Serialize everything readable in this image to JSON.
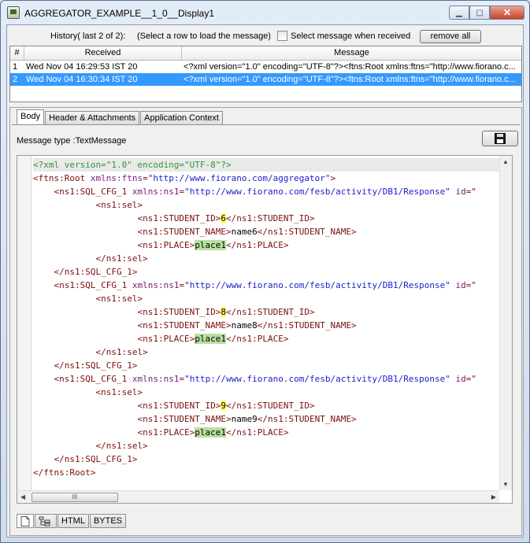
{
  "window": {
    "title": "AGGREGATOR_EXAMPLE__1_0__Display1",
    "minimize_icon": "minimize-icon",
    "maximize_icon": "maximize-icon",
    "close_icon": "close-icon"
  },
  "history": {
    "label": "History( last 2 of 2):",
    "instruction": "(Select a row to load the message)",
    "checkbox_label": "Select message when received",
    "checkbox_checked": false,
    "remove_all_label": "remove all"
  },
  "table": {
    "columns": [
      "#",
      "Received",
      "Message"
    ],
    "rows": [
      {
        "num": "1",
        "received": "Wed Nov 04 16:29:53 IST 20",
        "message": "<?xml version=\"1.0\" encoding=\"UTF-8\"?><ftns:Root xmlns:ftns=\"http://www.fiorano.c...",
        "selected": false
      },
      {
        "num": "2",
        "received": "Wed Nov 04 16:30:34 IST 20",
        "message": "<?xml version=\"1.0\" encoding=\"UTF-8\"?><ftns:Root xmlns:ftns=\"http://www.fiorano.c...",
        "selected": true
      }
    ]
  },
  "tabs": [
    "Body",
    "Header & Attachments",
    "Application Context"
  ],
  "active_tab": "Body",
  "body": {
    "message_type": "Message type :TextMessage",
    "save_icon": "floppy-disk-icon"
  },
  "code_lines": [
    {
      "n": "1",
      "indent": "",
      "parts": [
        [
          "pi",
          "<?xml version=\"1.0\" encoding=\"UTF-8\"?>"
        ]
      ]
    },
    {
      "n": "2",
      "indent": "",
      "parts": [
        [
          "tag",
          "<ftns:Root "
        ],
        [
          "attr",
          "xmlns:ftns"
        ],
        [
          "tag",
          "="
        ],
        [
          "val",
          "\"http://www.fiorano.com/aggregator\""
        ],
        [
          "tag",
          ">"
        ]
      ]
    },
    {
      "n": "3",
      "indent": "    ",
      "parts": [
        [
          "tag",
          "<ns1:SQL_CFG_1 "
        ],
        [
          "attr",
          "xmlns:ns1"
        ],
        [
          "tag",
          "="
        ],
        [
          "val",
          "\"http://www.fiorano.com/fesb/activity/DB1/Response\""
        ],
        [
          "tag",
          " "
        ],
        [
          "attr",
          "id"
        ],
        [
          "tag",
          "=\""
        ]
      ]
    },
    {
      "n": "4",
      "indent": "            ",
      "parts": [
        [
          "tag",
          "<ns1:sel>"
        ]
      ]
    },
    {
      "n": "5",
      "indent": "                    ",
      "parts": [
        [
          "tag",
          "<ns1:STUDENT_ID>"
        ],
        [
          "hly",
          "6"
        ],
        [
          "tag",
          "</ns1:STUDENT_ID>"
        ]
      ]
    },
    {
      "n": "6",
      "indent": "                    ",
      "parts": [
        [
          "tag",
          "<ns1:STUDENT_NAME>"
        ],
        [
          "text",
          "name6"
        ],
        [
          "tag",
          "</ns1:STUDENT_NAME>"
        ]
      ]
    },
    {
      "n": "7",
      "indent": "                    ",
      "parts": [
        [
          "tag",
          "<ns1:PLACE>"
        ],
        [
          "hlg",
          "place1"
        ],
        [
          "tag",
          "</ns1:PLACE>"
        ]
      ]
    },
    {
      "n": "8",
      "indent": "            ",
      "parts": [
        [
          "tag",
          "</ns1:sel>"
        ]
      ]
    },
    {
      "n": "9",
      "indent": "    ",
      "parts": [
        [
          "tag",
          "</ns1:SQL_CFG_1>"
        ]
      ]
    },
    {
      "n": "10",
      "indent": "    ",
      "parts": [
        [
          "tag",
          "<ns1:SQL_CFG_1 "
        ],
        [
          "attr",
          "xmlns:ns1"
        ],
        [
          "tag",
          "="
        ],
        [
          "val",
          "\"http://www.fiorano.com/fesb/activity/DB1/Response\""
        ],
        [
          "tag",
          " "
        ],
        [
          "attr",
          "id"
        ],
        [
          "tag",
          "=\""
        ]
      ]
    },
    {
      "n": "11",
      "indent": "            ",
      "parts": [
        [
          "tag",
          "<ns1:sel>"
        ]
      ]
    },
    {
      "n": "12",
      "indent": "                    ",
      "parts": [
        [
          "tag",
          "<ns1:STUDENT_ID>"
        ],
        [
          "hly",
          "8"
        ],
        [
          "tag",
          "</ns1:STUDENT_ID>"
        ]
      ]
    },
    {
      "n": "13",
      "indent": "                    ",
      "parts": [
        [
          "tag",
          "<ns1:STUDENT_NAME>"
        ],
        [
          "text",
          "name8"
        ],
        [
          "tag",
          "</ns1:STUDENT_NAME>"
        ]
      ]
    },
    {
      "n": "14",
      "indent": "                    ",
      "parts": [
        [
          "tag",
          "<ns1:PLACE>"
        ],
        [
          "hlg",
          "place1"
        ],
        [
          "tag",
          "</ns1:PLACE>"
        ]
      ]
    },
    {
      "n": "15",
      "indent": "            ",
      "parts": [
        [
          "tag",
          "</ns1:sel>"
        ]
      ]
    },
    {
      "n": "16",
      "indent": "    ",
      "parts": [
        [
          "tag",
          "</ns1:SQL_CFG_1>"
        ]
      ]
    },
    {
      "n": "17",
      "indent": "    ",
      "parts": [
        [
          "tag",
          "<ns1:SQL_CFG_1 "
        ],
        [
          "attr",
          "xmlns:ns1"
        ],
        [
          "tag",
          "="
        ],
        [
          "val",
          "\"http://www.fiorano.com/fesb/activity/DB1/Response\""
        ],
        [
          "tag",
          " "
        ],
        [
          "attr",
          "id"
        ],
        [
          "tag",
          "=\""
        ]
      ]
    },
    {
      "n": "18",
      "indent": "            ",
      "parts": [
        [
          "tag",
          "<ns1:sel>"
        ]
      ]
    },
    {
      "n": "19",
      "indent": "                    ",
      "parts": [
        [
          "tag",
          "<ns1:STUDENT_ID>"
        ],
        [
          "hly",
          "9"
        ],
        [
          "tag",
          "</ns1:STUDENT_ID>"
        ]
      ]
    },
    {
      "n": "20",
      "indent": "                    ",
      "parts": [
        [
          "tag",
          "<ns1:STUDENT_NAME>"
        ],
        [
          "text",
          "name9"
        ],
        [
          "tag",
          "</ns1:STUDENT_NAME>"
        ]
      ]
    },
    {
      "n": "21",
      "indent": "                    ",
      "parts": [
        [
          "tag",
          "<ns1:PLACE>"
        ],
        [
          "hlg",
          "place1"
        ],
        [
          "tag",
          "</ns1:PLACE>"
        ]
      ]
    },
    {
      "n": "22",
      "indent": "            ",
      "parts": [
        [
          "tag",
          "</ns1:sel>"
        ]
      ]
    },
    {
      "n": "23",
      "indent": "    ",
      "parts": [
        [
          "tag",
          "</ns1:SQL_CFG_1>"
        ]
      ]
    },
    {
      "n": "24",
      "indent": "",
      "parts": [
        [
          "tag",
          "</ftns:Root>"
        ]
      ]
    }
  ],
  "current_line": "1",
  "scrollbar_grip": "III",
  "bottom_tabs": [
    {
      "label": "",
      "icon": "document-icon"
    },
    {
      "label": "",
      "icon": "tree-view-icon"
    },
    {
      "label": "HTML",
      "icon": ""
    },
    {
      "label": "BYTES",
      "icon": ""
    }
  ],
  "colors": {
    "selection": "#3399ff",
    "tag": "#7a0f0f",
    "attr": "#7a1a7a",
    "value": "#1d1dcc",
    "pi": "#2d9a2d",
    "highlight_id": "#ffff66",
    "highlight_place": "#b8e0a0"
  }
}
